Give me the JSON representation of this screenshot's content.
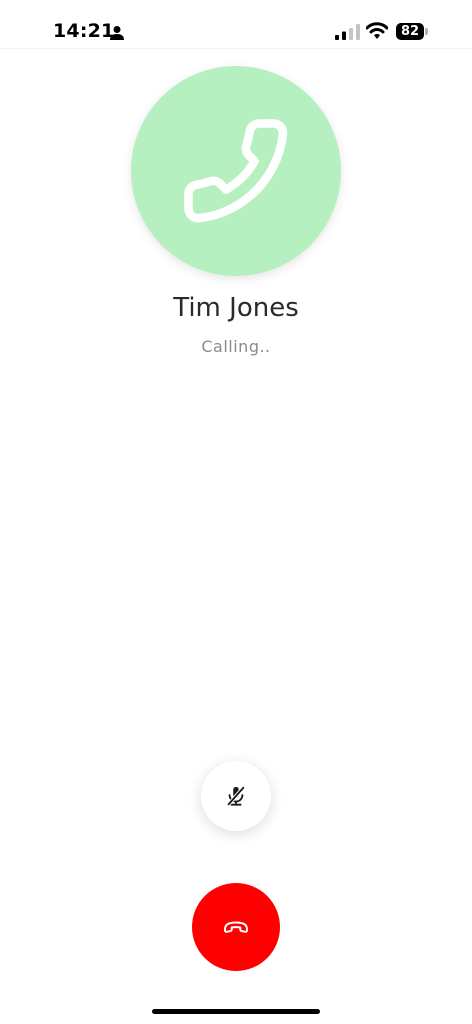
{
  "status_bar": {
    "time": "14:21",
    "battery_level": "82",
    "signal_strength": 2,
    "icons": [
      "person-icon",
      "signal-icon",
      "wifi-icon",
      "battery-icon"
    ]
  },
  "call": {
    "contact_name": "Tim Jones",
    "status": "Calling..",
    "avatar_icon": "phone-icon",
    "avatar_color": "#b6efc0"
  },
  "controls": {
    "mute_icon": "microphone-off-icon",
    "end_call_icon": "hang-up-icon",
    "end_call_color": "#ff0000"
  }
}
